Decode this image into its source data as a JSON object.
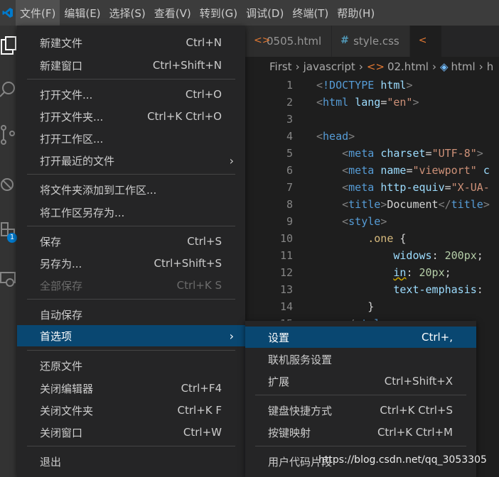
{
  "menubar": {
    "items": [
      "文件(F)",
      "编辑(E)",
      "选择(S)",
      "查看(V)",
      "转到(G)",
      "调试(D)",
      "终端(T)",
      "帮助(H)"
    ]
  },
  "tabs": [
    {
      "label": "0505.html",
      "icon": "<>"
    },
    {
      "label": "style.css",
      "icon": "#"
    },
    {
      "label": "",
      "icon": "<"
    }
  ],
  "breadcrumbs": [
    "First",
    "javascript",
    "02.html",
    "html",
    "h"
  ],
  "code": {
    "line_numbers": [
      "1",
      "2",
      "3",
      "4",
      "5",
      "6",
      "7",
      "8",
      "9",
      "10",
      "11",
      "12",
      "13",
      "14",
      "15"
    ]
  },
  "file_menu": {
    "items": [
      {
        "label": "新建文件",
        "shortcut": "Ctrl+N"
      },
      {
        "label": "新建窗口",
        "shortcut": "Ctrl+Shift+N"
      },
      {
        "label": "打开文件...",
        "shortcut": "Ctrl+O"
      },
      {
        "label": "打开文件夹...",
        "shortcut": "Ctrl+K Ctrl+O"
      },
      {
        "label": "打开工作区...",
        "shortcut": ""
      },
      {
        "label": "打开最近的文件",
        "shortcut": ""
      },
      {
        "label": "将文件夹添加到工作区...",
        "shortcut": ""
      },
      {
        "label": "将工作区另存为...",
        "shortcut": ""
      },
      {
        "label": "保存",
        "shortcut": "Ctrl+S"
      },
      {
        "label": "另存为...",
        "shortcut": "Ctrl+Shift+S"
      },
      {
        "label": "全部保存",
        "shortcut": "Ctrl+K S"
      },
      {
        "label": "自动保存",
        "shortcut": ""
      },
      {
        "label": "首选项",
        "shortcut": ""
      },
      {
        "label": "还原文件",
        "shortcut": ""
      },
      {
        "label": "关闭编辑器",
        "shortcut": "Ctrl+F4"
      },
      {
        "label": "关闭文件夹",
        "shortcut": "Ctrl+K F"
      },
      {
        "label": "关闭窗口",
        "shortcut": "Ctrl+W"
      },
      {
        "label": "退出",
        "shortcut": ""
      }
    ]
  },
  "pref_menu": {
    "items": [
      {
        "label": "设置",
        "shortcut": "Ctrl+,"
      },
      {
        "label": "联机服务设置",
        "shortcut": ""
      },
      {
        "label": "扩展",
        "shortcut": "Ctrl+Shift+X"
      },
      {
        "label": "键盘快捷方式",
        "shortcut": "Ctrl+K Ctrl+S"
      },
      {
        "label": "按键映射",
        "shortcut": "Ctrl+K Ctrl+M"
      },
      {
        "label": "用户代码片段",
        "shortcut": ""
      }
    ]
  },
  "watermark": "https://blog.csdn.net/qq_3053305",
  "badge_count": "1",
  "colors": {
    "accent": "#094771",
    "menubar": "#3c3c3c",
    "menu_bg": "#252526",
    "logo": "#007acc"
  }
}
